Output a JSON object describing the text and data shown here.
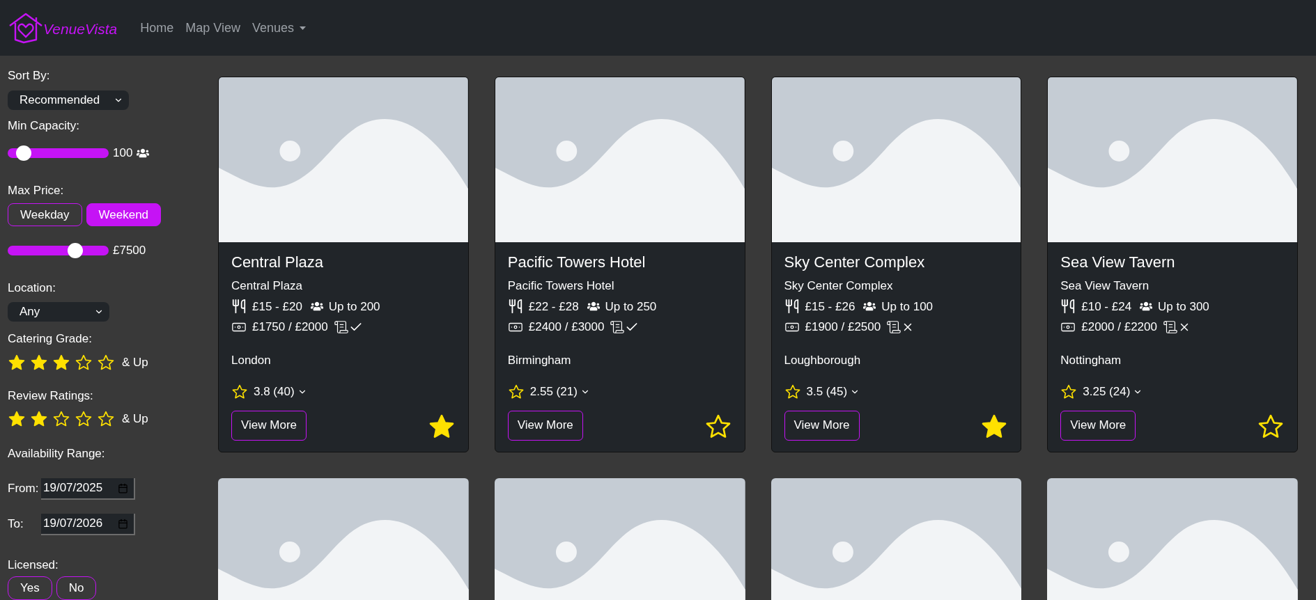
{
  "brand": {
    "name": "VenueVista"
  },
  "nav": [
    {
      "label": "Home",
      "kind": "link"
    },
    {
      "label": "Map View",
      "kind": "link"
    },
    {
      "label": "Venues",
      "kind": "dropdown"
    }
  ],
  "filters": {
    "sort": {
      "label": "Sort By:",
      "value": "Recommended"
    },
    "capacity": {
      "label": "Min Capacity:",
      "level": 0.1,
      "reading": "100"
    },
    "price": {
      "label": "Max Price:",
      "modes": [
        {
          "label": "Weekday",
          "selected": false
        },
        {
          "label": "Weekend",
          "selected": true
        }
      ],
      "level": 0.7,
      "reading": "£7500"
    },
    "location": {
      "label": "Location:",
      "value": "Any"
    },
    "catering": {
      "label": "Catering Grade:",
      "stars": 3,
      "suffix": "& Up"
    },
    "reviews": {
      "label": "Review Ratings:",
      "stars": 2,
      "suffix": "& Up"
    },
    "availability": {
      "label": "Availability Range:",
      "from_label": "From:",
      "from": "19/07/2025",
      "to_label": "To:",
      "to": "19/07/2026"
    },
    "licensed": {
      "label": "Licensed:",
      "options": [
        {
          "label": "Yes",
          "selected": false
        },
        {
          "label": "No",
          "selected": false
        }
      ]
    }
  },
  "venues": [
    {
      "title": "Central Plaza",
      "subtitle": "Central Plaza",
      "catering": "£15 - £20",
      "capacity": "Up to 200",
      "hire": "£1750 / £2000",
      "licensed": true,
      "city": "London",
      "rating": "3.8 (40)",
      "button": "View More",
      "favorite": true
    },
    {
      "title": "Pacific Towers Hotel",
      "subtitle": "Pacific Towers Hotel",
      "catering": "£22 - £28",
      "capacity": "Up to 250",
      "hire": "£2400 / £3000",
      "licensed": true,
      "city": "Birmingham",
      "rating": "2.55 (21)",
      "button": "View More",
      "favorite": false
    },
    {
      "title": "Sky Center Complex",
      "subtitle": "Sky Center Complex",
      "catering": "£15 - £26",
      "capacity": "Up to 100",
      "hire": "£1900 / £2500",
      "licensed": false,
      "city": "Loughborough",
      "rating": "3.5 (45)",
      "button": "View More",
      "favorite": true
    },
    {
      "title": "Sea View Tavern",
      "subtitle": "Sea View Tavern",
      "catering": "£10 - £24",
      "capacity": "Up to 300",
      "hire": "£2000 / £2200",
      "licensed": false,
      "city": "Nottingham",
      "rating": "3.25 (24)",
      "button": "View More",
      "favorite": false
    }
  ]
}
